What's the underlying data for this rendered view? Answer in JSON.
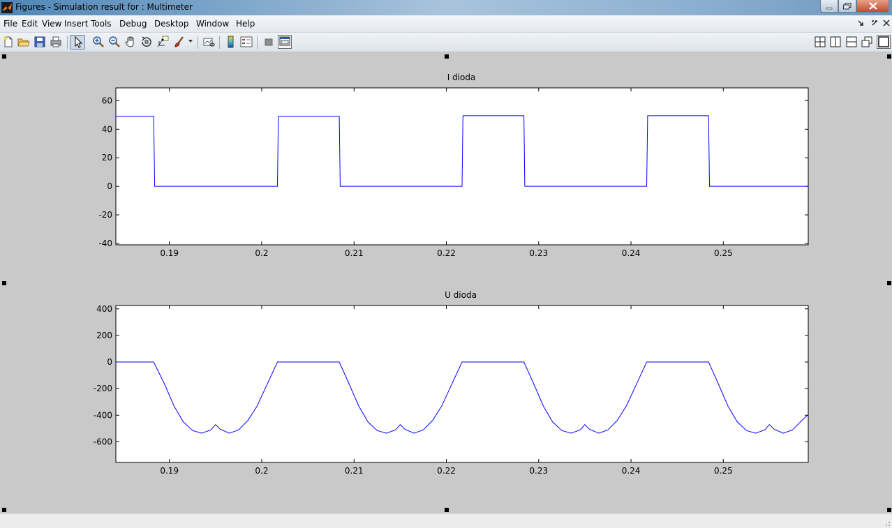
{
  "window": {
    "title": "Figures - Simulation result for : Multimeter"
  },
  "menu": {
    "items": [
      "File",
      "Edit",
      "View",
      "Insert",
      "Tools",
      "Debug",
      "Desktop",
      "Window",
      "Help"
    ]
  },
  "toolbar": {
    "left_icons": [
      "new-figure-icon",
      "open-file-icon",
      "save-icon",
      "print-icon",
      "select-pointer-icon",
      "zoom-in-icon",
      "zoom-out-icon",
      "pan-hand-icon",
      "rotate-3d-icon",
      "data-cursor-icon",
      "brush-icon",
      "link-plot-icon",
      "colorbar-icon",
      "legend-icon",
      "hide-plot-tools-icon",
      "show-plot-tools-icon"
    ],
    "right_icons": [
      "tile-grid-icon",
      "tile-columns-icon",
      "tile-rows-icon",
      "float-icon",
      "dock-icon"
    ]
  },
  "colors": {
    "line": "#0000ff",
    "figure_bg": "#c9c9c9"
  },
  "chart_data": [
    {
      "type": "line",
      "title": "I dioda",
      "xlim": [
        0.1842,
        0.2592
      ],
      "ylim": [
        -41,
        69
      ],
      "xticks": [
        0.19,
        0.2,
        0.21,
        0.22,
        0.23,
        0.24,
        0.25
      ],
      "xtick_labels": [
        "0.19",
        "0.2",
        "0.21",
        "0.22",
        "0.23",
        "0.24",
        "0.25"
      ],
      "yticks": [
        -40,
        -20,
        0,
        20,
        40,
        60
      ],
      "ytick_labels": [
        "-40",
        "-20",
        "0",
        "20",
        "40",
        "60"
      ],
      "grid": false,
      "series": [
        {
          "x": [
            0.1842,
            0.1883,
            0.1884,
            0.2017,
            0.2018,
            0.2084,
            0.2085,
            0.2217,
            0.2218,
            0.2284,
            0.2285,
            0.2417,
            0.2418,
            0.2484,
            0.2485,
            0.2592
          ],
          "y": [
            49,
            49,
            0,
            0,
            49,
            49,
            0,
            0,
            49.5,
            49.5,
            0,
            0,
            49.5,
            49.5,
            0,
            0
          ]
        }
      ]
    },
    {
      "type": "line",
      "title": "U dioda",
      "xlim": [
        0.1842,
        0.2592
      ],
      "ylim": [
        -755,
        425
      ],
      "xticks": [
        0.19,
        0.2,
        0.21,
        0.22,
        0.23,
        0.24,
        0.25
      ],
      "xtick_labels": [
        "0.19",
        "0.2",
        "0.21",
        "0.22",
        "0.23",
        "0.24",
        "0.25"
      ],
      "yticks": [
        -600,
        -400,
        -200,
        0,
        200,
        400
      ],
      "ytick_labels": [
        "-600",
        "-400",
        "-200",
        "0",
        "200",
        "400"
      ],
      "grid": false,
      "series": [
        {
          "x": [
            0.1842,
            0.1883,
            0.1895,
            0.1905,
            0.1915,
            0.1925,
            0.1935,
            0.1945,
            0.195,
            0.1955,
            0.1965,
            0.1975,
            0.1985,
            0.1995,
            0.2005,
            0.2017,
            0.2084,
            0.2095,
            0.2105,
            0.2115,
            0.2125,
            0.2135,
            0.2145,
            0.215,
            0.2155,
            0.2165,
            0.2175,
            0.2185,
            0.2195,
            0.2205,
            0.2217,
            0.2284,
            0.2295,
            0.2305,
            0.2315,
            0.2325,
            0.2335,
            0.2345,
            0.235,
            0.2355,
            0.2365,
            0.2375,
            0.2385,
            0.2395,
            0.2405,
            0.2417,
            0.2484,
            0.2495,
            0.2505,
            0.2515,
            0.2525,
            0.2535,
            0.2545,
            0.255,
            0.2555,
            0.2565,
            0.2575,
            0.2585,
            0.2592
          ],
          "y": [
            0,
            0,
            -170,
            -330,
            -450,
            -515,
            -535,
            -510,
            -470,
            -505,
            -535,
            -510,
            -440,
            -330,
            -180,
            0,
            0,
            -170,
            -330,
            -450,
            -515,
            -535,
            -510,
            -470,
            -505,
            -535,
            -510,
            -440,
            -330,
            -180,
            0,
            0,
            -170,
            -330,
            -450,
            -515,
            -535,
            -510,
            -470,
            -505,
            -535,
            -510,
            -440,
            -330,
            -180,
            0,
            0,
            -170,
            -330,
            -450,
            -515,
            -535,
            -510,
            -470,
            -505,
            -535,
            -510,
            -440,
            -395
          ]
        }
      ]
    }
  ]
}
